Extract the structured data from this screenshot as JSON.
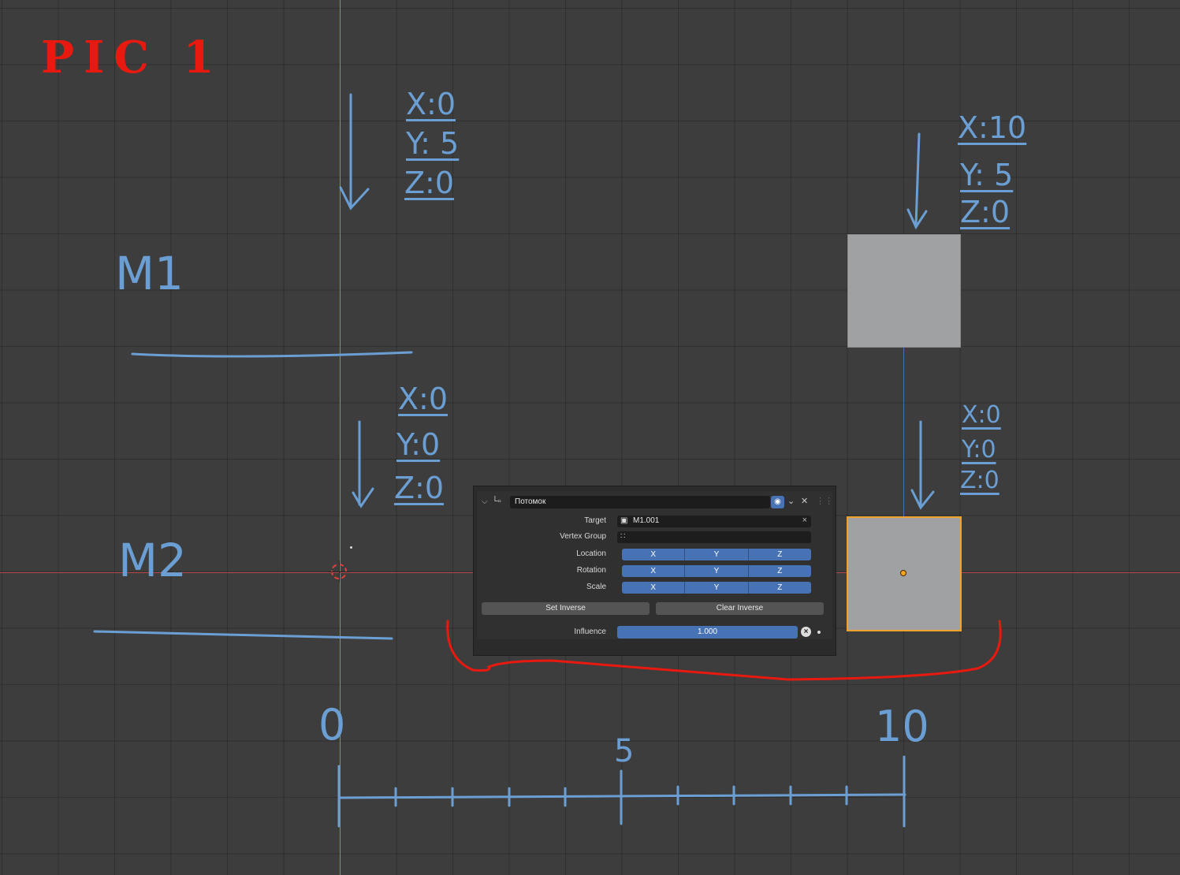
{
  "title": "PIC 1",
  "annotations": {
    "m1_label": "M1",
    "m2_label": "M2",
    "m1_coords": [
      "X:0",
      "Y: 5",
      "Z:0"
    ],
    "m2_coords": [
      "X:0",
      "Y:0",
      "Z:0"
    ],
    "cube_top_coords": [
      "X:10",
      "Y: 5",
      "Z:0"
    ],
    "cube_bottom_coords": [
      "X:0",
      "Y:0",
      "Z:0"
    ],
    "scale_labels": [
      "0",
      "5",
      "10"
    ]
  },
  "constraint_panel": {
    "name": "Потомок",
    "target_label": "Target",
    "target_value": "M1.001",
    "vertex_group_label": "Vertex Group",
    "vertex_group_value": "",
    "location_label": "Location",
    "rotation_label": "Rotation",
    "scale_label": "Scale",
    "axes": [
      "X",
      "Y",
      "Z"
    ],
    "set_inverse": "Set Inverse",
    "clear_inverse": "Clear Inverse",
    "influence_label": "Influence",
    "influence_value": "1.000"
  },
  "colors": {
    "annotation": "#6b9fd4",
    "title": "#e8190f",
    "highlight_brace": "#e8190f",
    "accent": "#4772b3",
    "selection": "#f0a32c"
  },
  "icons": {
    "collapse": "chevron-down-icon",
    "constraint": "child-of-constraint-icon",
    "visibility": "eye-icon",
    "remove": "close-icon",
    "object": "object-icon",
    "vertex_group": "vertex-group-icon"
  }
}
